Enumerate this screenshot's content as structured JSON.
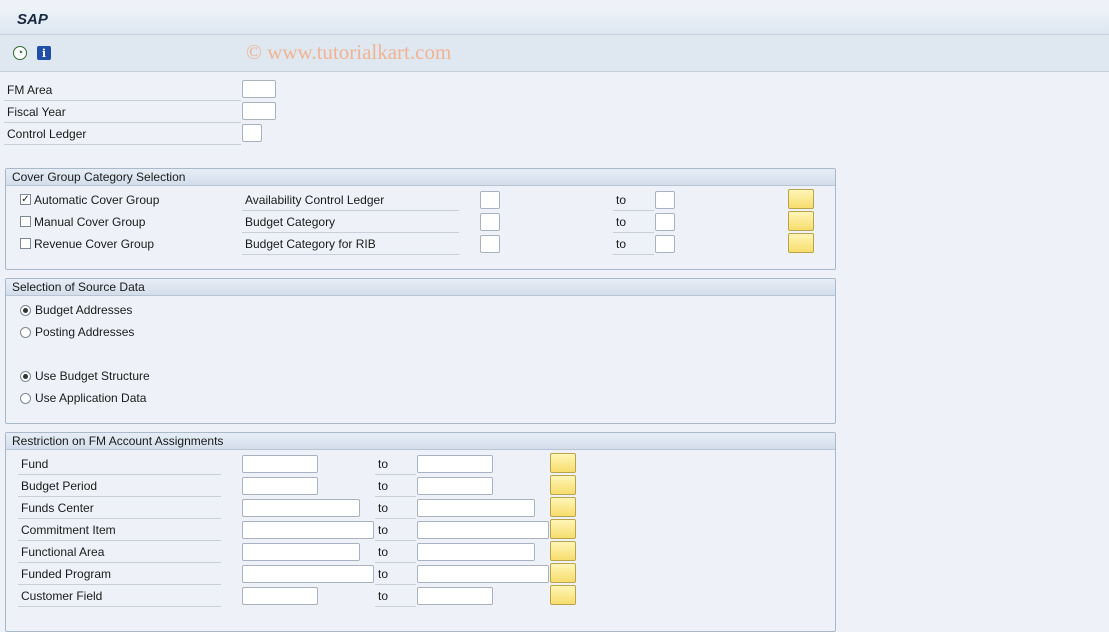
{
  "app": {
    "title": "SAP",
    "watermark": "© www.tutorialkart.com"
  },
  "toolbar": {
    "execute_icon": "execute-icon",
    "info_icon": "info-icon",
    "info_glyph": "i"
  },
  "header_fields": [
    {
      "label": "FM Area",
      "value": ""
    },
    {
      "label": "Fiscal Year",
      "value": ""
    },
    {
      "label": "Control Ledger",
      "value": ""
    }
  ],
  "cover_group": {
    "title": "Cover Group Category Selection",
    "rows": [
      {
        "checkbox_label": "Automatic Cover Group",
        "checked": true,
        "field_label": "Availability Control Ledger",
        "from": "",
        "to_label": "to",
        "to": ""
      },
      {
        "checkbox_label": "Manual Cover Group",
        "checked": false,
        "field_label": "Budget Category",
        "from": "",
        "to_label": "to",
        "to": ""
      },
      {
        "checkbox_label": "Revenue Cover Group",
        "checked": false,
        "field_label": "Budget Category for RIB",
        "from": "",
        "to_label": "to",
        "to": ""
      }
    ],
    "check_mark": "✓"
  },
  "source_data": {
    "title": "Selection of Source Data",
    "options_a": [
      {
        "label": "Budget Addresses",
        "selected": true
      },
      {
        "label": "Posting Addresses",
        "selected": false
      }
    ],
    "options_b": [
      {
        "label": "Use Budget Structure",
        "selected": true
      },
      {
        "label": "Use Application Data",
        "selected": false
      }
    ]
  },
  "restriction": {
    "title": "Restriction on FM Account Assignments",
    "rows": [
      {
        "label": "Fund",
        "from": "",
        "to_label": "to",
        "to": ""
      },
      {
        "label": "Budget Period",
        "from": "",
        "to_label": "to",
        "to": ""
      },
      {
        "label": "Funds Center",
        "from": "",
        "to_label": "to",
        "to": ""
      },
      {
        "label": "Commitment Item",
        "from": "",
        "to_label": "to",
        "to": ""
      },
      {
        "label": "Functional Area",
        "from": "",
        "to_label": "to",
        "to": ""
      },
      {
        "label": "Funded Program",
        "from": "",
        "to_label": "to",
        "to": ""
      },
      {
        "label": "Customer Field",
        "from": "",
        "to_label": "to",
        "to": ""
      }
    ]
  }
}
